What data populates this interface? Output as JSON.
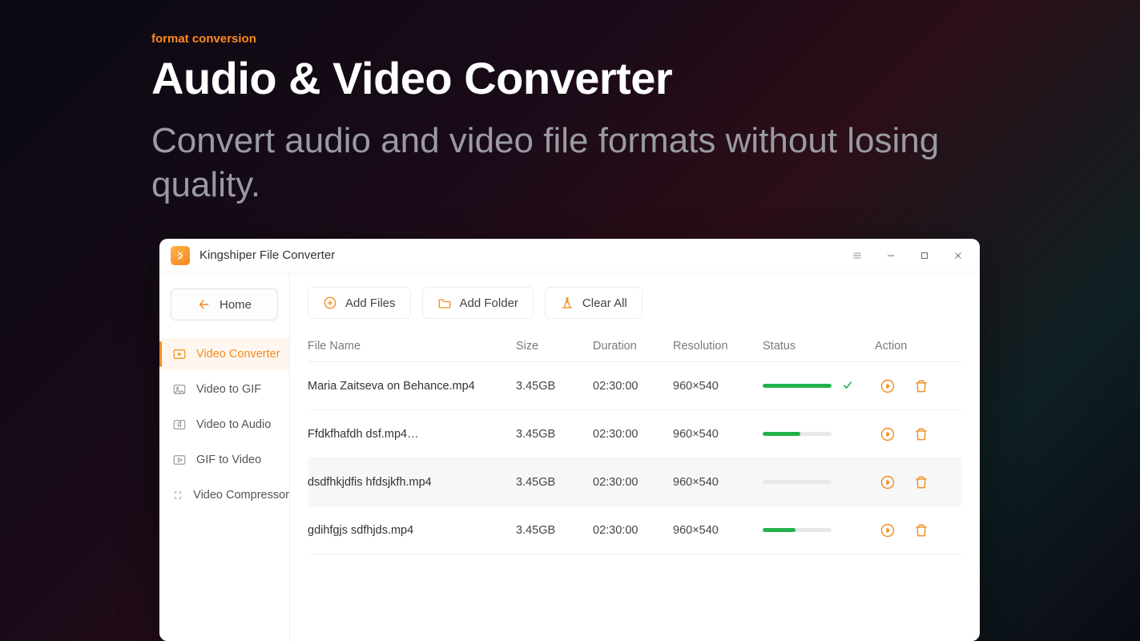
{
  "hero": {
    "eyebrow": "format conversion",
    "title": "Audio & Video Converter",
    "subtitle": "Convert audio and video file formats without losing quality."
  },
  "window": {
    "title": "Kingshiper File Converter"
  },
  "sidebar": {
    "home_label": "Home",
    "items": [
      {
        "id": "video-converter",
        "label": "Video Converter",
        "active": true
      },
      {
        "id": "video-to-gif",
        "label": "Video to GIF",
        "active": false
      },
      {
        "id": "video-to-audio",
        "label": "Video to Audio",
        "active": false
      },
      {
        "id": "gif-to-video",
        "label": "GIF to Video",
        "active": false
      },
      {
        "id": "video-compressor",
        "label": "Video Compressor",
        "active": false
      }
    ]
  },
  "toolbar": {
    "add_files": "Add Files",
    "add_folder": "Add Folder",
    "clear_all": "Clear All"
  },
  "table": {
    "headers": {
      "name": "File Name",
      "size": "Size",
      "duration": "Duration",
      "resolution": "Resolution",
      "status": "Status",
      "action": "Action"
    },
    "rows": [
      {
        "name": "Maria Zaitseva on Behance.mp4",
        "size": "3.45GB",
        "duration": "02:30:00",
        "resolution": "960×540",
        "progress": 100,
        "done": true,
        "selected": false
      },
      {
        "name": "Ffdkfhafdh dsf.mp4…",
        "size": "3.45GB",
        "duration": "02:30:00",
        "resolution": "960×540",
        "progress": 55,
        "done": false,
        "selected": false
      },
      {
        "name": "dsdfhkjdfis hfdsjkfh.mp4",
        "size": "3.45GB",
        "duration": "02:30:00",
        "resolution": "960×540",
        "progress": 0,
        "done": false,
        "selected": true
      },
      {
        "name": "gdihfgjs sdfhjds.mp4",
        "size": "3.45GB",
        "duration": "02:30:00",
        "resolution": "960×540",
        "progress": 48,
        "done": false,
        "selected": false
      }
    ]
  },
  "colors": {
    "accent": "#f38b1e",
    "success": "#22b24c"
  }
}
